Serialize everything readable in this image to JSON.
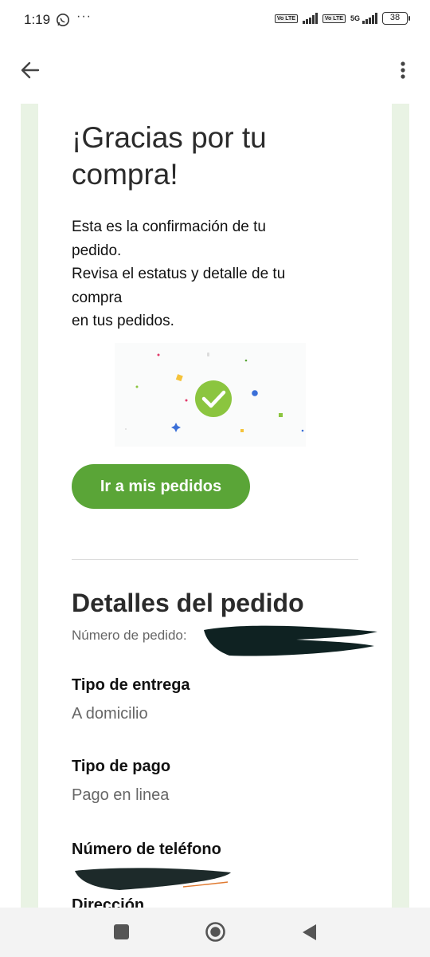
{
  "status_bar": {
    "time": "1:19",
    "more": "···",
    "network": "5G",
    "volte_label": "Vo LTE",
    "battery": "38",
    "icons": [
      "whatsapp-icon",
      "volte-icon",
      "signal-icon",
      "battery-icon"
    ]
  },
  "app_bar": {
    "icons": [
      "back-arrow-icon",
      "more-vert-icon"
    ]
  },
  "page": {
    "title_line1": "¡Gracias por tu",
    "title_line2": "compra!",
    "intro_line1": "Esta es la confirmación de tu",
    "intro_line2": "pedido.",
    "intro_line3": "Revisa el estatus y detalle de tu",
    "intro_line4": "compra",
    "intro_line5": "en tus pedidos.",
    "confetti_icon": "check-circle-icon",
    "cta_label": "Ir a mis pedidos"
  },
  "details": {
    "title": "Detalles del pedido",
    "order_number_label": "Número de pedido:",
    "delivery_label": "Tipo de entrega",
    "delivery_value": "A domicilio",
    "payment_label": "Tipo de pago",
    "payment_value": "Pago en linea",
    "phone_label": "Número de teléfono",
    "address_label": "Dirección"
  },
  "colors": {
    "accent": "#5aa537",
    "gutter": "#e9f3e4",
    "check": "#8bc53f"
  },
  "nav_bar": {
    "icons": [
      "recents-square-icon",
      "home-circle-icon",
      "back-triangle-icon"
    ]
  }
}
